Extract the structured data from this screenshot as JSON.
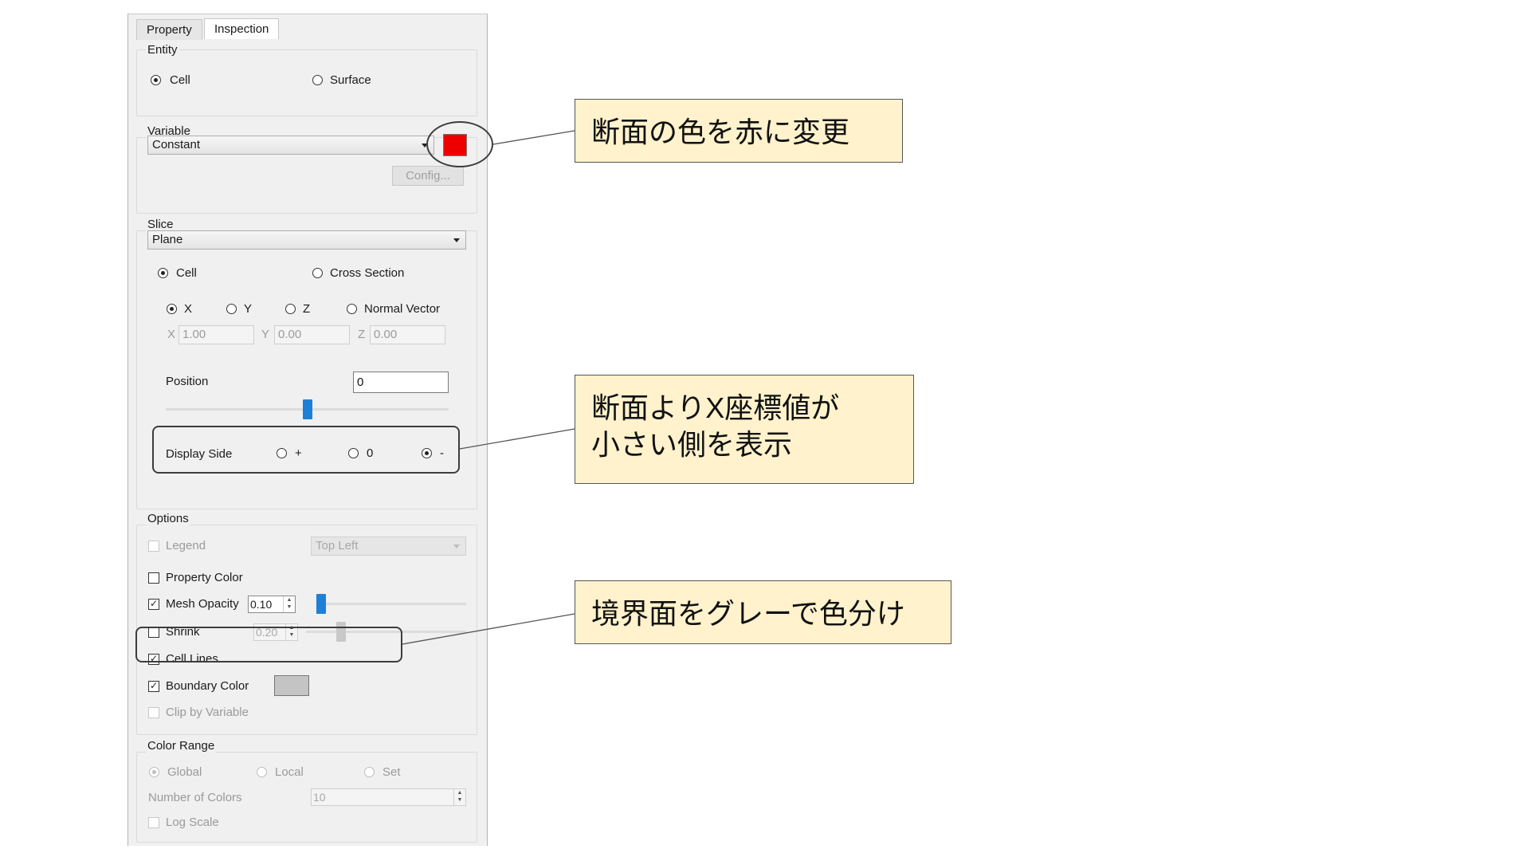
{
  "tabs": [
    {
      "label": "Property"
    },
    {
      "label": "Inspection"
    }
  ],
  "entity": {
    "title": "Entity",
    "options": [
      "Cell",
      "Surface"
    ],
    "selected": "Cell"
  },
  "variable": {
    "title": "Variable",
    "value": "Constant",
    "config_label": "Config...",
    "color": "#ee0000"
  },
  "slice": {
    "title": "Slice",
    "type_value": "Plane",
    "mode_options": [
      "Cell",
      "Cross Section"
    ],
    "mode_selected": "Cell",
    "axis_options": [
      "X",
      "Y",
      "Z",
      "Normal Vector"
    ],
    "axis_selected": "X",
    "vector": [
      {
        "label": "X",
        "value": "1.00"
      },
      {
        "label": "Y",
        "value": "0.00"
      },
      {
        "label": "Z",
        "value": "0.00"
      }
    ],
    "position_label": "Position",
    "position_value": "0",
    "position_slider_fraction": 0.5,
    "display_side_label": "Display Side",
    "display_side_options": [
      "+",
      "0",
      "-"
    ],
    "display_side_selected": "-"
  },
  "options": {
    "title": "Options",
    "legend_label": "Legend",
    "legend_position": "Top Left",
    "property_color_label": "Property Color",
    "mesh_opacity_label": "Mesh Opacity",
    "mesh_opacity_value": "0.10",
    "mesh_opacity_fraction": 0.0,
    "shrink_label": "Shrink",
    "shrink_value": "0.20",
    "shrink_fraction": 0.2,
    "cell_lines_label": "Cell Lines",
    "boundary_color_label": "Boundary Color",
    "boundary_color": "#c4c4c4",
    "clip_label": "Clip by Variable"
  },
  "color_range": {
    "title": "Color Range",
    "options": [
      "Global",
      "Local",
      "Set"
    ],
    "selected": "Global",
    "num_colors_label": "Number of Colors",
    "num_colors_value": "10",
    "log_scale_label": "Log Scale"
  },
  "callouts": [
    {
      "text": "断面の色を赤に変更"
    },
    {
      "text": "断面よりX座標値が\n小さい側を表示"
    },
    {
      "text": "境界面をグレーで色分け"
    }
  ],
  "colors": {
    "callout_fill": "#fff2cc",
    "accent": "#1e7fd8"
  }
}
